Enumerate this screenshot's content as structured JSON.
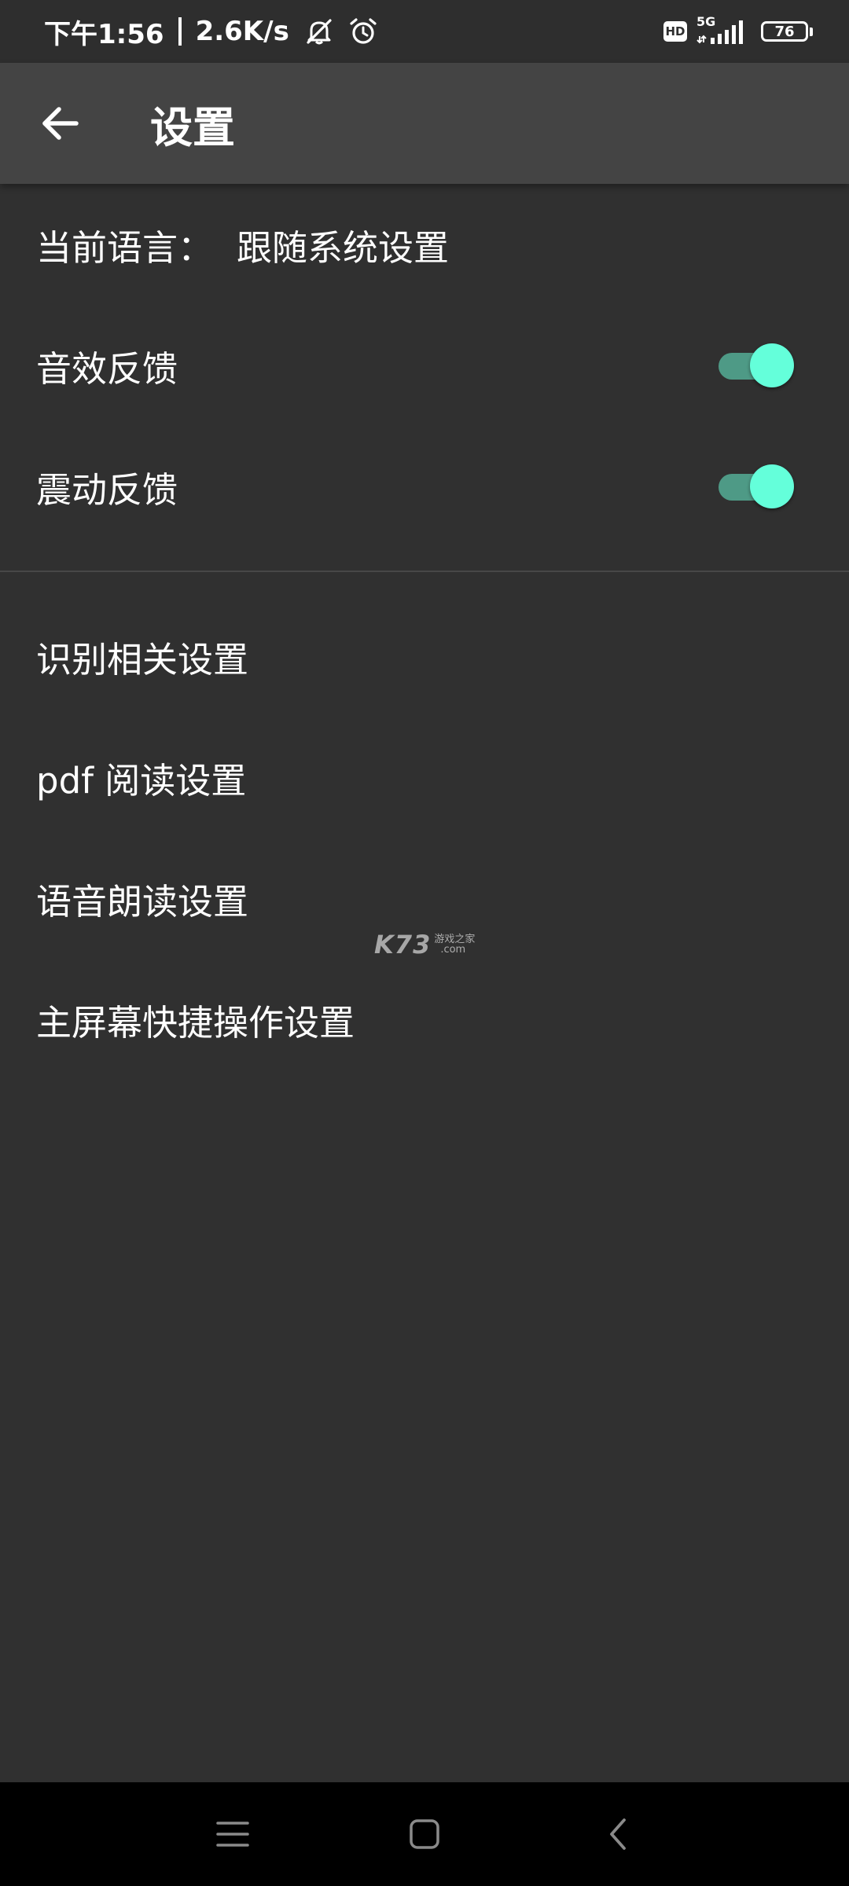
{
  "status_bar": {
    "time": "下午1:56",
    "speed": "2.6K/s",
    "network_type": "5G",
    "hd_label": "HD",
    "battery_level": "76",
    "icons": [
      "mute-icon",
      "alarm-icon",
      "hd-icon",
      "signal-icon",
      "battery-icon"
    ]
  },
  "toolbar": {
    "title": "设置",
    "back_icon": "arrow-left-icon"
  },
  "settings": {
    "language_label": "当前语言：",
    "language_value": "跟随系统设置",
    "sound_feedback": {
      "label": "音效反馈",
      "enabled": true
    },
    "vibration_feedback": {
      "label": "震动反馈",
      "enabled": true
    },
    "items": [
      {
        "label": "识别相关设置"
      },
      {
        "label": "pdf 阅读设置"
      },
      {
        "label": "语音朗读设置"
      },
      {
        "label": "主屏幕快捷操作设置"
      }
    ]
  },
  "watermark": {
    "main": "K73",
    "cn": "游戏之家",
    "com": ".com"
  },
  "colors": {
    "background": "#303030",
    "toolbar": "#444444",
    "switch_thumb": "#64ffda",
    "switch_track": "#4e9a86",
    "nav_bar": "#000000"
  },
  "nav_bar": {
    "icons": [
      "menu-icon",
      "home-icon",
      "back-icon"
    ]
  }
}
